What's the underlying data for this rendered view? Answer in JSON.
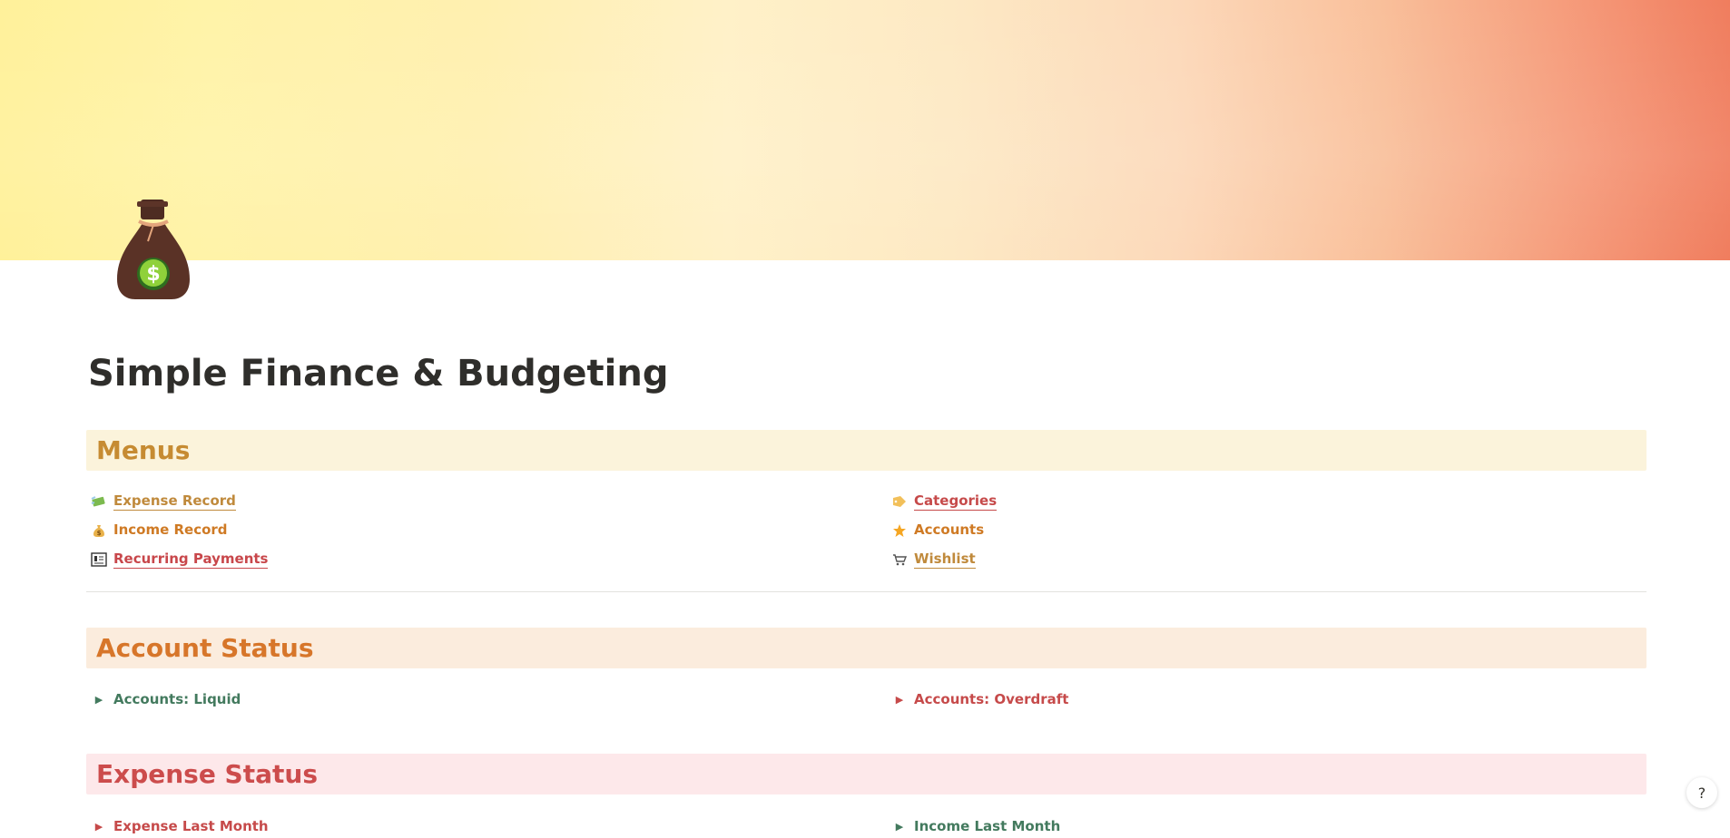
{
  "page": {
    "title": "Simple Finance & Budgeting",
    "icon": "money-bag-icon"
  },
  "sections": {
    "menus": {
      "heading": "Menus"
    },
    "account_status": {
      "heading": "Account Status"
    },
    "expense_status": {
      "heading": "Expense Status"
    }
  },
  "menus": {
    "left": [
      {
        "label": "Expense Record",
        "icon": "money-with-wings-icon"
      },
      {
        "label": "Income Record",
        "icon": "money-bag-icon"
      },
      {
        "label": "Recurring Payments",
        "icon": "receipt-icon"
      }
    ],
    "right": [
      {
        "label": "Categories",
        "icon": "label-tag-icon"
      },
      {
        "label": "Accounts",
        "icon": "star-icon"
      },
      {
        "label": "Wishlist",
        "icon": "shopping-cart-icon"
      }
    ]
  },
  "account_status": {
    "left": {
      "label": "Accounts: Liquid"
    },
    "right": {
      "label": "Accounts: Overdraft"
    }
  },
  "expense_status": {
    "left": {
      "label": "Expense Last Month"
    },
    "right": {
      "label": "Income Last Month"
    }
  },
  "help": {
    "label": "?"
  },
  "colors": {
    "menus_header_bg": "#fbf3db",
    "menus_header_text": "#c68b32",
    "account_header_bg": "#fbecdd",
    "account_header_text": "#d7762a",
    "expense_header_bg": "#fde8ea",
    "expense_header_text": "#cc4c4c",
    "link_green": "#437a5e",
    "link_red": "#c8474b"
  }
}
